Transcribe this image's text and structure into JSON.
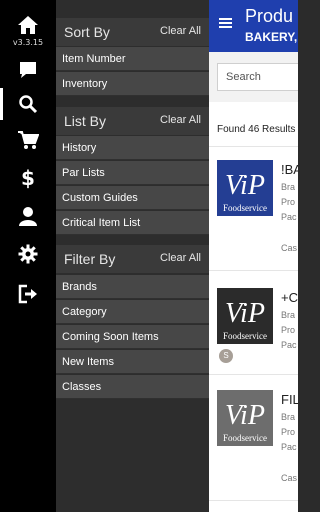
{
  "rail": {
    "version": "v3.3.15",
    "items": [
      {
        "icon": "home-icon"
      },
      {
        "icon": "chat-icon"
      },
      {
        "icon": "search-icon"
      },
      {
        "icon": "cart-icon"
      },
      {
        "icon": "dollar-icon"
      },
      {
        "icon": "user-icon"
      },
      {
        "icon": "gear-icon"
      },
      {
        "icon": "logout-icon"
      }
    ]
  },
  "panel": {
    "sort": {
      "title": "Sort By",
      "clear": "Clear All",
      "options": [
        "Item Number",
        "Inventory"
      ]
    },
    "list": {
      "title": "List By",
      "clear": "Clear All",
      "options": [
        "History",
        "Par Lists",
        "Custom Guides",
        "Critical Item List"
      ]
    },
    "filter": {
      "title": "Filter By",
      "clear": "Clear All",
      "options": [
        "Brands",
        "Category",
        "Coming Soon Items",
        "New Items",
        "Classes"
      ]
    }
  },
  "main": {
    "title": "Produ",
    "subtitle": "BAKERY,",
    "search_placeholder": "Search",
    "found": "Found 46 Results",
    "products": [
      {
        "name": "!BA",
        "meta": [
          "Bra",
          "Pro",
          "Pac"
        ],
        "case": "Cas",
        "badge": ""
      },
      {
        "name": "+C",
        "meta": [
          "Bra",
          "Pro",
          "Pac"
        ],
        "case": "",
        "badge": "S"
      },
      {
        "name": "FIL",
        "meta": [
          "Bra",
          "Pro",
          "Pac"
        ],
        "case": "Cas",
        "badge": ""
      }
    ],
    "logo_text": {
      "vip": "ViP",
      "food": "Foodservice"
    }
  },
  "colors": {
    "header": "#1f3fae",
    "rail": "#000000",
    "panel": "#2d2d2d"
  }
}
